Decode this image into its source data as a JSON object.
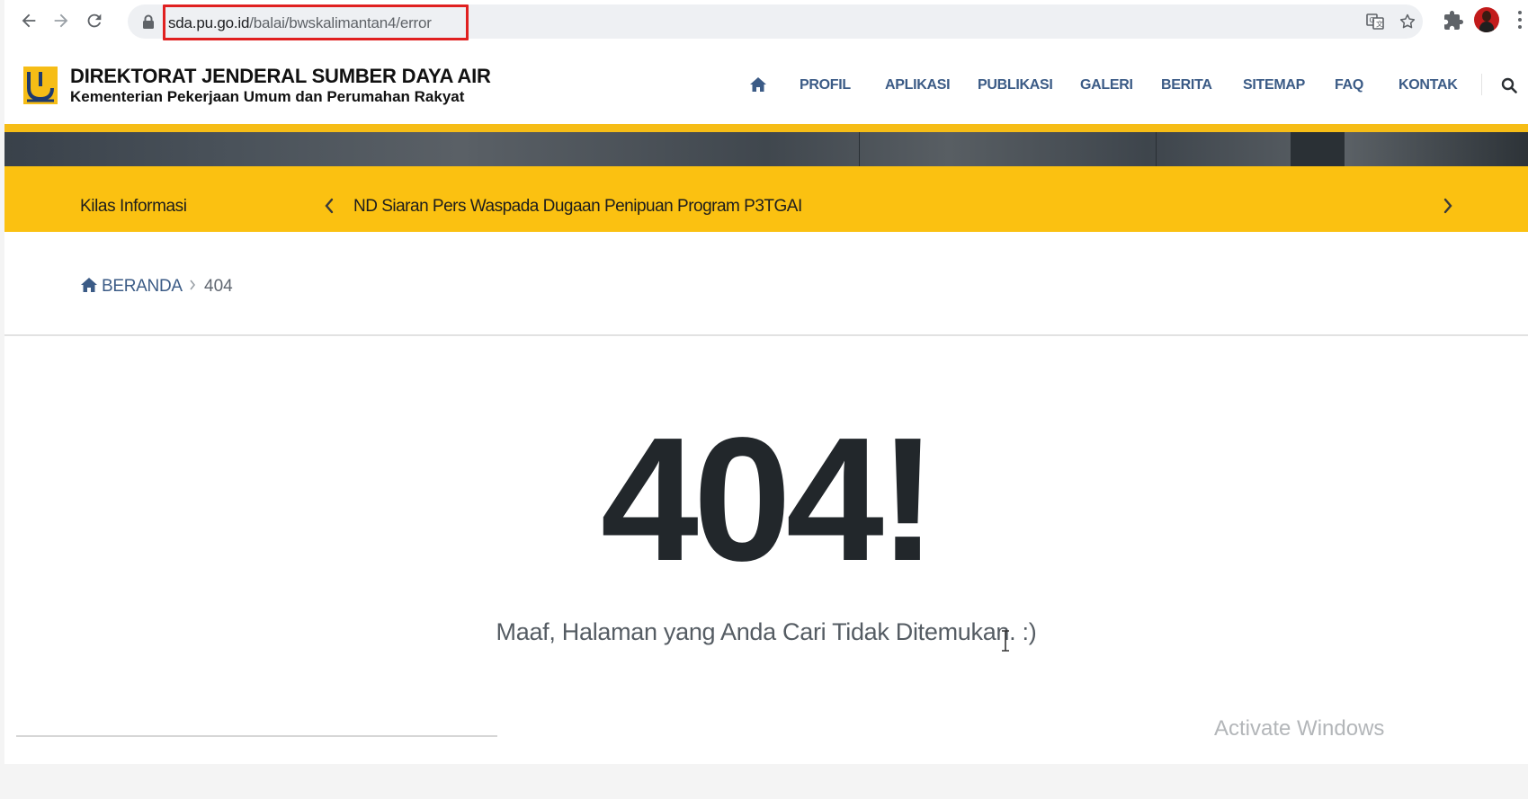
{
  "browser": {
    "url_domain": "sda.pu.go.id",
    "url_path": "/balai/bwskalimantan4/error",
    "back_icon": "arrow-left-icon",
    "forward_icon": "arrow-right-icon",
    "reload_icon": "reload-icon",
    "highlight_color": "#e02020"
  },
  "header": {
    "title": "DIREKTORAT JENDERAL SUMBER DAYA AIR",
    "subtitle": "Kementerian Pekerjaan Umum dan Perumahan Rakyat",
    "accent_color": "#f6bd16",
    "menu": [
      {
        "label": "PROFIL"
      },
      {
        "label": "APLIKASI"
      },
      {
        "label": "PUBLIKASI"
      },
      {
        "label": "GALERI"
      },
      {
        "label": "BERITA"
      },
      {
        "label": "SITEMAP"
      },
      {
        "label": "FAQ"
      },
      {
        "label": "KONTAK"
      }
    ],
    "menu_color": "#3b5b86"
  },
  "ticker": {
    "label": "Kilas Informasi",
    "text": "ND Siaran Pers Waspada Dugaan Penipuan Program P3TGAI",
    "background": "#fbc111"
  },
  "breadcrumb": {
    "home": "BERANDA",
    "current": "404"
  },
  "error": {
    "code": "404!",
    "message": "Maaf, Halaman yang Anda Cari Tidak Ditemukan. :)"
  },
  "os": {
    "watermark": "Activate Windows"
  }
}
